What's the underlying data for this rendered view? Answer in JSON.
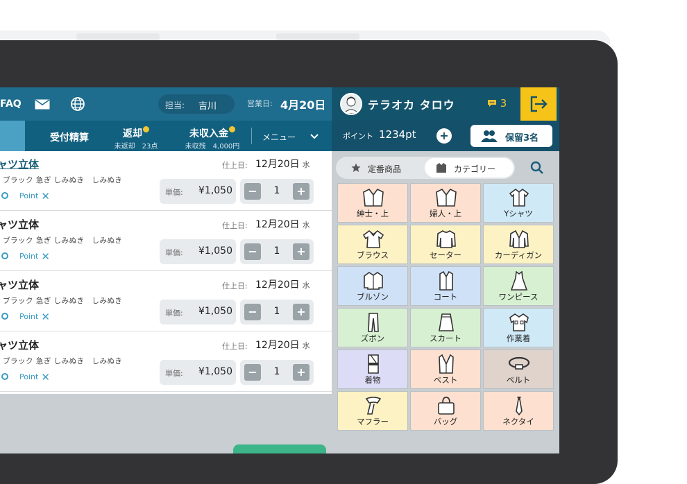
{
  "header": {
    "faq": "FAQ",
    "tanto_label": "担当:",
    "tanto_value": "吉川",
    "eigyo_label": "営業日:",
    "eigyo_value": "4月20日"
  },
  "tabs": [
    {
      "label": "受付精算",
      "sub": ""
    },
    {
      "label": "返却",
      "sub": "未返却　23点"
    },
    {
      "label": "未収入金",
      "sub": "未収残　4,000円"
    }
  ],
  "menu_label": "メニュー",
  "items": [
    {
      "name": "ャツ立体",
      "tags": "ブラック 急ぎ しみぬき　しみぬき",
      "point": "Point",
      "finish_label": "仕上日:",
      "finish_date": "12月20日",
      "finish_dow": "水",
      "price_label": "単価:",
      "price": "¥1,050",
      "qty": "1"
    },
    {
      "name": "ャツ立体",
      "tags": "ブラック 急ぎ しみぬき　しみぬき",
      "point": "Point",
      "finish_label": "仕上日:",
      "finish_date": "12月20日",
      "finish_dow": "水",
      "price_label": "単価:",
      "price": "¥1,050",
      "qty": "1"
    },
    {
      "name": "ャツ立体",
      "tags": "ブラック 急ぎ しみぬき　しみぬき",
      "point": "Point",
      "finish_label": "仕上日:",
      "finish_date": "12月20日",
      "finish_dow": "水",
      "price_label": "単価:",
      "price": "¥1,050",
      "qty": "1"
    },
    {
      "name": "ャツ立体",
      "tags": "ブラック 急ぎ しみぬき　しみぬき",
      "point": "Point",
      "finish_label": "仕上日:",
      "finish_date": "12月20日",
      "finish_dow": "水",
      "price_label": "単価:",
      "price": "¥1,050",
      "qty": "1"
    }
  ],
  "customer": {
    "name": "テラオカ タロウ",
    "messages": "3",
    "point_label": "ポイント",
    "point_value": "1234pt",
    "hold_label": "保留3名"
  },
  "segments": [
    "定番商品",
    "カテゴリー"
  ],
  "categories": [
    {
      "label": "紳士・上",
      "color": "#fde0cf",
      "icon": "jacket-icon"
    },
    {
      "label": "婦人・上",
      "color": "#fde0cf",
      "icon": "jacket-icon"
    },
    {
      "label": "Yシャツ",
      "color": "#cfe9f7",
      "icon": "shirt-icon"
    },
    {
      "label": "ブラウス",
      "color": "#fdf2c4",
      "icon": "blouse-icon"
    },
    {
      "label": "セーター",
      "color": "#fdf2c4",
      "icon": "sweater-icon"
    },
    {
      "label": "カーディガン",
      "color": "#fdf2c4",
      "icon": "cardigan-icon"
    },
    {
      "label": "ブルゾン",
      "color": "#cfe1f6",
      "icon": "blouson-icon"
    },
    {
      "label": "コート",
      "color": "#cfe1f6",
      "icon": "coat-icon"
    },
    {
      "label": "ワンピース",
      "color": "#d7f0d2",
      "icon": "dress-icon"
    },
    {
      "label": "ズボン",
      "color": "#d7f0d2",
      "icon": "pants-icon"
    },
    {
      "label": "スカート",
      "color": "#d7f0d2",
      "icon": "skirt-icon"
    },
    {
      "label": "作業着",
      "color": "#cfe9f7",
      "icon": "workwear-icon"
    },
    {
      "label": "着物",
      "color": "#dcdcf6",
      "icon": "kimono-icon"
    },
    {
      "label": "ベスト",
      "color": "#fde0cf",
      "icon": "vest-icon"
    },
    {
      "label": "ベルト",
      "color": "#dfd3cc",
      "icon": "belt-icon"
    },
    {
      "label": "マフラー",
      "color": "#fdf2c4",
      "icon": "scarf-icon"
    },
    {
      "label": "バッグ",
      "color": "#fde0cf",
      "icon": "bag-icon"
    },
    {
      "label": "ネクタイ",
      "color": "#fde0cf",
      "icon": "necktie-icon"
    }
  ]
}
